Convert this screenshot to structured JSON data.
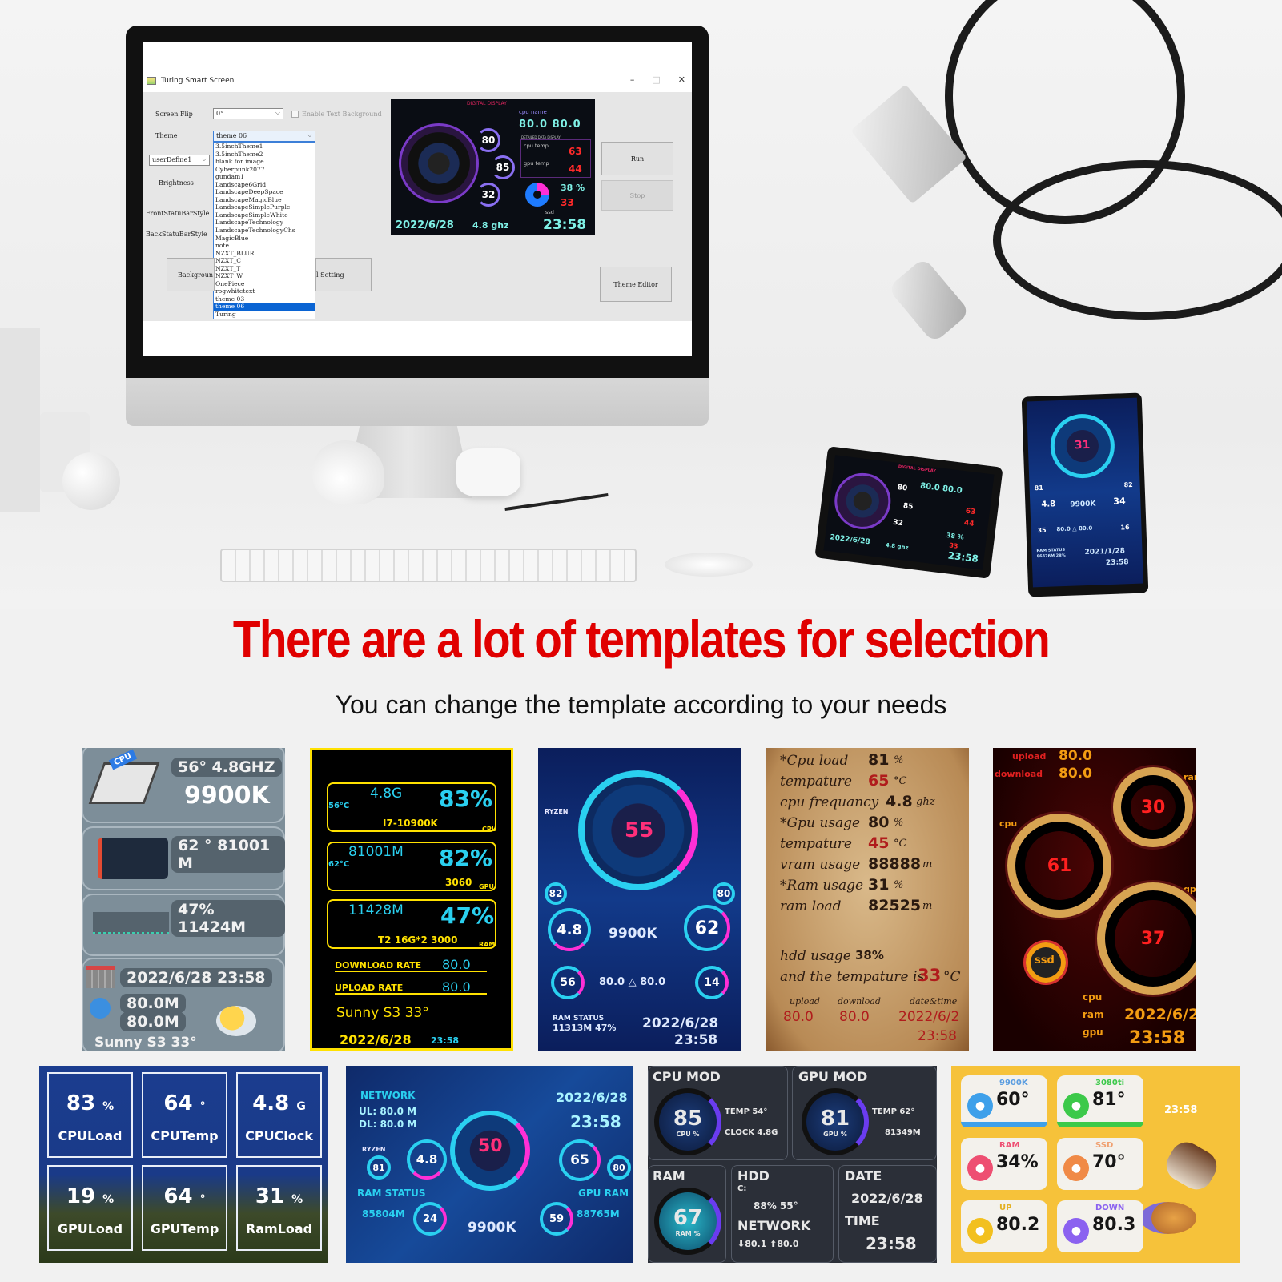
{
  "app": {
    "title": "Turing Smart Screen",
    "window_controls": {
      "minimize": "–",
      "maximize": "□",
      "close": "✕"
    },
    "screen_flip": {
      "label": "Screen Flip",
      "value": "0°"
    },
    "enable_text_background": {
      "label": "Enable Text Background",
      "checked": false
    },
    "theme": {
      "label": "Theme",
      "value": "theme 06",
      "options": [
        "3.5inchTheme1",
        "3.5inchTheme2",
        "blank for image",
        "Cyberpunk2077",
        "gundam1",
        "Landscape6Grid",
        "LandscapeDeepSpace",
        "LandscapeMagicBlue",
        "LandscapeSimplePurple",
        "LandscapeSimpleWhite",
        "LandscapeTechnology",
        "LandscapeTechnologyChs",
        "MagicBlue",
        "note",
        "NZXT_BLUR",
        "NZXT_C",
        "NZXT_T",
        "NZXT_W",
        "OnePiece",
        "rogwhitetext",
        "theme 03",
        "theme 06",
        "Turing"
      ],
      "selected_index": 21
    },
    "user_define": {
      "value": "userDefine1"
    },
    "brightness_label": "Brightness",
    "front_status_label": "FrontStatuBarStyle",
    "back_status_label": "BackStatuBarStyle",
    "background_button": "Backgroun",
    "setting_button": "l Setting",
    "run_button": "Run",
    "stop_button": "Stop",
    "theme_editor_button": "Theme Editor",
    "preview": {
      "header": "DIGITAL DISPLAY",
      "cpu_name_label": "cpu name",
      "values_top": "80.0  80.0",
      "detail_label": "DETAILED DATA DISPLAY",
      "cpu_temp_label": "cpu temp",
      "cpu_temp": "63",
      "gpu_temp_label": "gpu temp",
      "gpu_temp": "44",
      "ring_values": [
        "80",
        "85",
        "32"
      ],
      "ssd_percent": "38 %",
      "ssd_temp": "33",
      "ssd_label": "ssd",
      "date": "2022/6/28",
      "ghz": "4.8 ghz",
      "time": "23:58"
    }
  },
  "devices": {
    "landscape": {
      "header": "DIGITAL DISPLAY",
      "values_top": "80.0 80.0",
      "cpu_temp": "63",
      "gpu_temp": "44",
      "ring_values": [
        "80",
        "85",
        "32"
      ],
      "ssd_percent": "38 %",
      "ssd_temp": "33",
      "date": "2022/6/28",
      "ghz": "4.8 ghz",
      "time": "23:58"
    },
    "portrait": {
      "center": "31",
      "left_small": "81",
      "right_small": "82",
      "left_ring": "4.8",
      "right_ring": "34",
      "cpu_model": "9900K",
      "net": "80.0 △ 80.0",
      "bottom_left": "35",
      "bottom_right": "16",
      "ram_label": "RAM STATUS",
      "ram_value": "86876M 28%",
      "date": "2021/1/28",
      "time": "23:58"
    }
  },
  "headline": "There are a lot of templates for selection",
  "subheadline": "You can change the template according to your needs",
  "templates": {
    "t1": {
      "cpu_tag": "CPU",
      "cpu_stats": "56°  4.8GHZ",
      "cpu_model": "9900K",
      "gpu_stats": "62 °  81001 M",
      "ram_stats": "47% 11424M",
      "datetime": "2022/6/28   23:58",
      "net_up": "80.0M",
      "net_down": "80.0M",
      "weather": "Sunny   S3  33°"
    },
    "t2": {
      "cpu_freq": "4.8G",
      "cpu_temp": "56°C",
      "cpu_load": "83%",
      "cpu_name": "I7-10900K",
      "cpu_tag": "CPU",
      "gpu_mem": "81001M",
      "gpu_temp": "62°C",
      "gpu_load": "82%",
      "gpu_name": "3060",
      "gpu_tag": "GPU",
      "ram_used": "11428M",
      "ram_load": "47%",
      "ram_name": "T2 16G*2 3000",
      "ram_tag": "RAM",
      "download_label": "DOWNLOAD RATE",
      "download": "80.0",
      "upload_label": "UPLOAD RATE",
      "upload": "80.0",
      "weather": "Sunny   S3  33°",
      "date": "2022/6/28",
      "time": "23:58"
    },
    "t3": {
      "brand": "RYZEN",
      "center": "55",
      "left_small": "82",
      "right_small": "80",
      "left_ring": "4.8",
      "right_ring": "62",
      "cpu_model": "9900K",
      "net": "80.0 △ 80.0",
      "bottom_left": "56",
      "bottom_right": "14",
      "ram_label": "RAM STATUS",
      "ram_value": "11313M 47%",
      "date": "2022/6/28",
      "time": "23:58"
    },
    "t4": {
      "rows": [
        {
          "label": "*Cpu load",
          "value": "81",
          "unit": "%"
        },
        {
          "label": "tempature",
          "value": "65",
          "unit": "°C",
          "red": true
        },
        {
          "label": "cpu frequancy",
          "value": "4.8",
          "unit": "ghz"
        },
        {
          "label": "*Gpu usage",
          "value": "80",
          "unit": "%"
        },
        {
          "label": "tempature",
          "value": "45",
          "unit": "°C",
          "red": true
        },
        {
          "label": "vram usage",
          "value": "88888",
          "unit": "m"
        },
        {
          "label": "*Ram usage",
          "value": "31",
          "unit": "%"
        },
        {
          "label": "ram load",
          "value": "82525",
          "unit": "m"
        }
      ],
      "hdd_label": "hdd usage",
      "hdd_value": "38%",
      "temp_sentence": "and the tempature is",
      "temp_value": "33",
      "temp_unit": "°C",
      "upload_label": "upload",
      "download_label": "download",
      "datetime_label": "date&time",
      "upload": "80.0",
      "download": "80.0",
      "date": "2022/6/2",
      "time": "23:58"
    },
    "t5": {
      "upload_label": "upload",
      "upload": "80.0",
      "download_label": "download",
      "download": "80.0",
      "cpu_label": "cpu",
      "ram_label": "ram",
      "gpu_label": "gpu",
      "cpu": "61",
      "ram": "30",
      "gpu": "37",
      "ssd_label": "ssd",
      "legend": [
        "cpu",
        "ram",
        "gpu"
      ],
      "date": "2022/6/2",
      "time": "23:58"
    },
    "t6": {
      "cells": [
        {
          "value": "83",
          "unit": "%",
          "label": "CPULoad"
        },
        {
          "value": "64",
          "unit": "°",
          "label": "CPUTemp"
        },
        {
          "value": "4.8",
          "unit": "G",
          "label": "CPUClock"
        },
        {
          "value": "19",
          "unit": "%",
          "label": "GPULoad"
        },
        {
          "value": "64",
          "unit": "°",
          "label": "GPUTemp"
        },
        {
          "value": "31",
          "unit": "%",
          "label": "RamLoad"
        }
      ]
    },
    "t7": {
      "network_label": "NETWORK",
      "ul": "UL:  80.0 M",
      "dl": "DL:  80.0 M",
      "date": "2022/6/28",
      "time": "23:58",
      "brand": "RYZEN",
      "left_small": "81",
      "left_ring": "4.8",
      "center": "50",
      "right_ring": "65",
      "right_small": "80",
      "ram_label": "RAM  STATUS",
      "ram_value": "85804M",
      "ram_ring": "24",
      "cpu_model": "9900K",
      "gpu_ring": "59",
      "gpu_ram_label": "GPU RAM",
      "gpu_ram_value": "88765M"
    },
    "t8": {
      "cpu_title": "CPU MOD",
      "cpu_value": "85",
      "cpu_unit": "CPU %",
      "cpu_temp": "TEMP    54°",
      "cpu_clock": "CLOCK  4.8G",
      "gpu_title": "GPU MOD",
      "gpu_value": "81",
      "gpu_unit": "GPU %",
      "gpu_temp": "TEMP    62°",
      "gpu_mem": "81349M",
      "ram_title": "RAM",
      "ram_value": "67",
      "ram_unit": "RAM %",
      "hdd_title": "HDD",
      "hdd_drive": "C:",
      "hdd_stats": "88%   55°",
      "network_title": "NETWORK",
      "network_values": "⬇80.1 ⬆80.0",
      "date_title": "DATE",
      "date": "2022/6/28",
      "time_title": "TIME",
      "time": "23:58"
    },
    "t9": {
      "cards": [
        {
          "caption": "9900K",
          "value": "60°",
          "color": "#3ea0ea",
          "caption_color": "#5a9de0",
          "bar": true
        },
        {
          "caption": "3080ti",
          "value": "81°",
          "color": "#3cc94a",
          "caption_color": "#3cc94a",
          "bar": true
        },
        {
          "caption": "RAM",
          "value": "34%",
          "color": "#ee4f72",
          "caption_color": "#ee4f72",
          "bar": false
        },
        {
          "caption": "SSD",
          "value": "70°",
          "color": "#f08a47",
          "caption_color": "#f0a070",
          "bar": false
        },
        {
          "caption": "UP",
          "value": "80.2",
          "color": "#f2c01f",
          "caption_color": "#e3b020",
          "bar": false
        },
        {
          "caption": "DOWN",
          "value": "80.3",
          "color": "#8b62f0",
          "caption_color": "#8b62f0",
          "bar": false
        }
      ],
      "time": "23:58"
    }
  }
}
